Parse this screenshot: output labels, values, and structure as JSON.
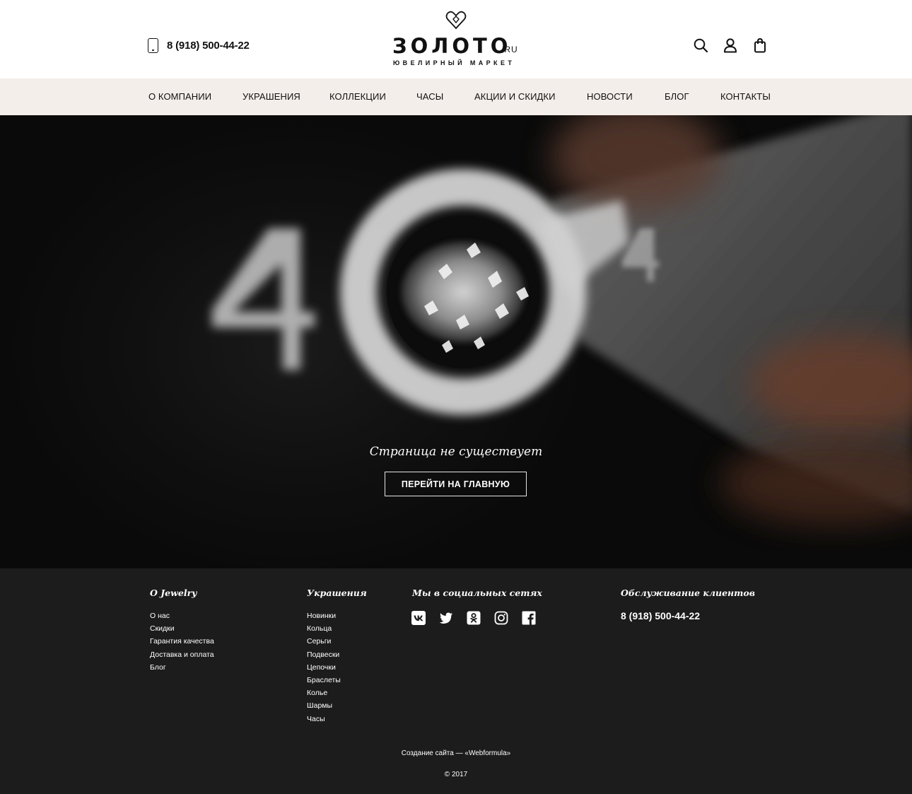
{
  "header": {
    "phone": "8 (918) 500-44-22",
    "logo": {
      "word": "ЗОЛОТО",
      "suffix": ".RU",
      "tagline": "ЮВЕЛИРНЫЙ МАРКЕТ"
    },
    "icons": [
      "search-icon",
      "user-icon",
      "bag-icon"
    ]
  },
  "nav": {
    "items": [
      {
        "label": "О КОМПАНИИ"
      },
      {
        "label": "УКРАШЕНИЯ"
      },
      {
        "label": "КОЛЛЕКЦИИ"
      },
      {
        "label": "ЧАСЫ"
      },
      {
        "label": "АКЦИИ И СКИДКИ"
      },
      {
        "label": "НОВОСТИ"
      },
      {
        "label": "БЛОГ"
      },
      {
        "label": "КОНТАКТЫ"
      }
    ]
  },
  "hero": {
    "title": "Страница не существует",
    "button": "ПЕРЕЙТИ НА ГЛАВНУЮ"
  },
  "footer": {
    "about": {
      "title": "О Jewelry",
      "links": [
        "О нас",
        "Скидки",
        "Гарантия качества",
        "Доставка и оплата",
        "Блог"
      ]
    },
    "jewelry": {
      "title": "Украшения",
      "links": [
        "Новинки",
        "Кольца",
        "Серьги",
        "Подвески",
        "Цепочки",
        "Браслеты",
        "Колье",
        "Шармы",
        "Часы"
      ]
    },
    "social": {
      "title": "Мы в социальных сетях",
      "icons": [
        "vk-icon",
        "twitter-icon",
        "odnoklassniki-icon",
        "instagram-icon",
        "facebook-icon"
      ]
    },
    "service": {
      "title": "Обслуживание клиентов",
      "phone": "8 (918) 500-44-22"
    },
    "credit": "Создание сайта — «Webformula»",
    "copyright": "© 2017"
  },
  "colors": {
    "nav_bg": "#f4eeea",
    "footer_bg": "#1c1c1c",
    "hero_bg": "#0d0d0d"
  }
}
